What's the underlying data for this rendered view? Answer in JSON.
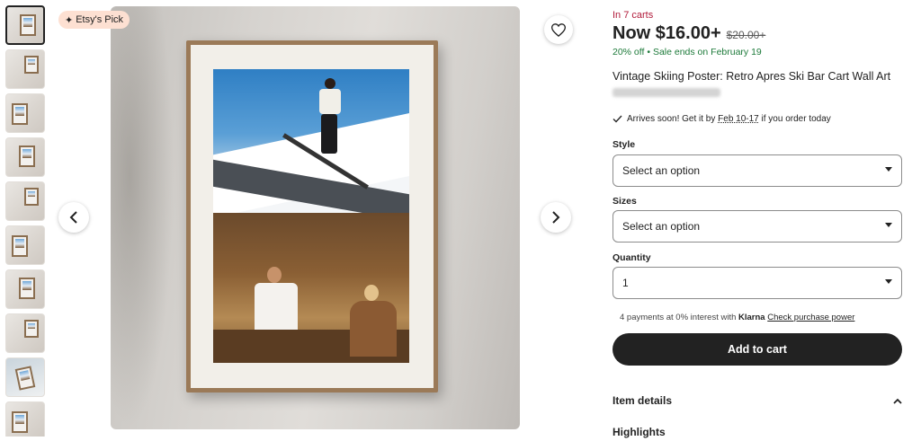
{
  "badge": {
    "label": "Etsy's Pick",
    "icon": "sparkle-icon"
  },
  "gallery": {
    "thumbnail_count": 10
  },
  "listing": {
    "in_carts": "In 7 carts",
    "price_now": "Now $16.00+",
    "price_old": "$20.00+",
    "discount": "20% off",
    "sale_ends": "Sale ends on February 19",
    "title": "Vintage Skiing Poster: Retro Apres Ski Bar Cart Wall Art"
  },
  "delivery": {
    "prefix": "Arrives soon! Get it by",
    "dates": "Feb 10-17",
    "suffix": "if you order today"
  },
  "options": {
    "style_label": "Style",
    "style_value": "Select an option",
    "sizes_label": "Sizes",
    "sizes_value": "Select an option",
    "quantity_label": "Quantity",
    "quantity_value": "1"
  },
  "klarna": {
    "text": "4 payments at 0% interest with",
    "brand": "Klarna",
    "link": "Check purchase power"
  },
  "cart_button": "Add to cart",
  "sections": {
    "item_details": "Item details",
    "highlights": "Highlights"
  },
  "colors": {
    "cart_red": "#b11a3a",
    "sale_green": "#1d7a3a",
    "button_dark": "#222222",
    "badge_bg": "#fde0d2"
  }
}
